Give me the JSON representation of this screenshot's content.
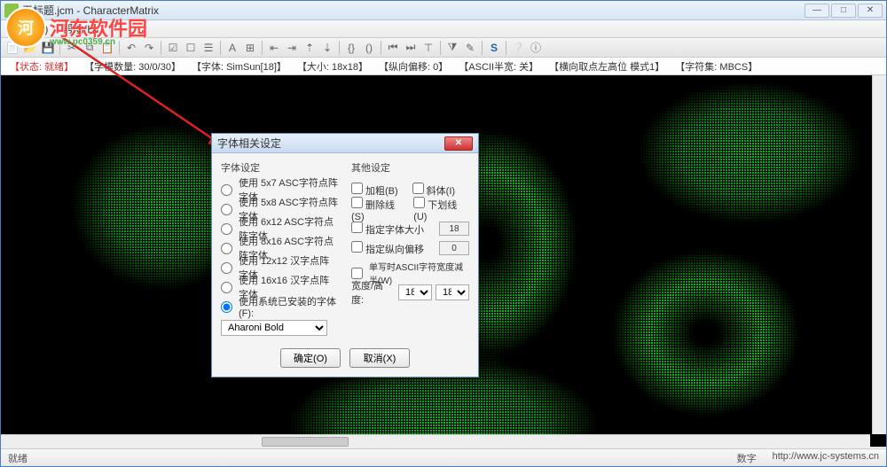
{
  "window": {
    "title": "无标题.jcm - CharacterMatrix"
  },
  "menu": {
    "transfer": "传输(T)",
    "help": "帮助(H)"
  },
  "info": {
    "state": "【状态: 就绪】",
    "chars": "【字模数量: 30/0/30】",
    "font": "【字体: SimSun[18]】",
    "size": "【大小: 18x18】",
    "voffset": "【纵向偏移: 0】",
    "ascii": "【ASCII半宽: 关】",
    "hmode": "【横向取点左高位 模式1】",
    "charset": "【字符集: MBCS】"
  },
  "watermark": {
    "brand": "河东软件园",
    "url": "www.pc0359.cn"
  },
  "dialog": {
    "title": "字体相关设定",
    "leftGroup": "字体设定",
    "rightGroup": "其他设定",
    "r1": "使用 5x7 ASC字符点阵字体",
    "r2": "使用 5x8 ASC字符点阵字体",
    "r3": "使用 6x12 ASC字符点阵字体",
    "r4": "使用 8x16 ASC字符点阵字体",
    "r5": "使用 12x12 汉字点阵字体",
    "r6": "使用 16x16 汉字点阵字体",
    "r7": "使用系统已安装的字体(F):",
    "fontName": "Aharoni Bold",
    "bold": "加粗(B)",
    "italic": "斜体(I)",
    "strike": "删除线(S)",
    "underline": "下划线(U)",
    "specSize": "指定字体大小",
    "specSizeVal": "18",
    "specVOff": "指定纵向偏移",
    "specVOffVal": "0",
    "halfAscii": "单写时ASCII字符宽度减半(W)",
    "whLabel": "宽度/高度:",
    "wVal": "18",
    "hVal": "18",
    "ok": "确定(O)",
    "cancel": "取消(X)"
  },
  "status": {
    "ready": "就绪",
    "digit": "数字",
    "url": "http://www.jc-systems.cn"
  }
}
